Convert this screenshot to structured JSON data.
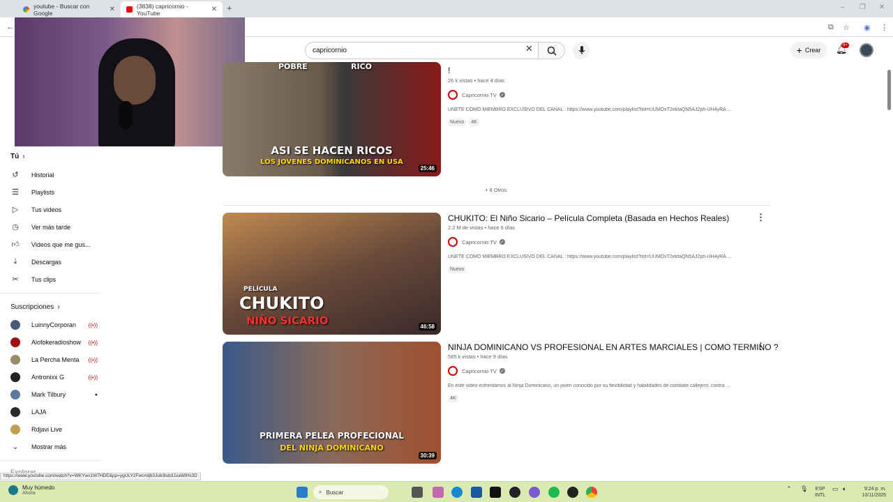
{
  "browser": {
    "tabs": [
      {
        "label": "youtube - Buscar con Google"
      },
      {
        "label": "(3838) capricornio - YouTube"
      }
    ],
    "status_url": "https://www.youtube.com/watch?v=WKYwx1W7HDE&pp=ygULY2Fwcmljb3Jub3lub3JuaW8%3D"
  },
  "header": {
    "search_value": "capricornio",
    "create_label": "Crear",
    "notif_count": "9+"
  },
  "sidebar": {
    "you_label": "Tú",
    "you_items": [
      {
        "label": "Historial",
        "icon": "history-icon"
      },
      {
        "label": "Playlists",
        "icon": "playlist-icon"
      },
      {
        "label": "Tus videos",
        "icon": "video-icon"
      },
      {
        "label": "Ver más tarde",
        "icon": "clock-icon"
      },
      {
        "label": "Videos que me gus...",
        "icon": "thumbs-up-icon"
      },
      {
        "label": "Descargas",
        "icon": "download-icon"
      },
      {
        "label": "Tus clips",
        "icon": "scissors-icon"
      }
    ],
    "subs_label": "Suscripciones",
    "subs": [
      {
        "label": "LuinnyCorporan",
        "status": "live",
        "color": "#4a5a7a"
      },
      {
        "label": "Alofokeradioshow",
        "status": "live",
        "color": "#a01010"
      },
      {
        "label": "La Percha Menta",
        "status": "live",
        "color": "#9a8a6a"
      },
      {
        "label": "Antronixx G",
        "status": "live",
        "color": "#222222"
      },
      {
        "label": "Mark Tilbury",
        "status": "new",
        "color": "#5a7aa0"
      },
      {
        "label": "LAJA",
        "status": "",
        "color": "#2a2a2a"
      },
      {
        "label": "Rdjavi Live",
        "status": "",
        "color": "#c0a050"
      }
    ],
    "show_more": "Mostrar más",
    "explore_label": "Explorar"
  },
  "videos": [
    {
      "title": "!",
      "views": "26 k vistas • hace 4 días",
      "channel": "Capricornio TV",
      "desc": "UNETE COMO MIEMBRO EXCLUSIVO DEL CANAL : https://www.youtube.com/playlist?list=UUMOxT2ekfaQN5AJ2ph-UH4yRA ...",
      "tags": [
        "Nuevo",
        "4K"
      ],
      "duration": "25:46",
      "thumb_text1": "POBRE",
      "thumb_text2": "RICO",
      "thumb_caption1": "ASI SE HACEN RICOS",
      "thumb_caption2": "LOS JOVENES DOMINICANOS EN USA"
    },
    {
      "title": "CHUKITO: El Niño Sicario – Película Completa (Basada en Hechos Reales)",
      "views": "2.2 M de vistas • hace 6 días",
      "channel": "Capricornio TV",
      "desc": "UNETE COMO MIEMBRO EXCLUSIVO DEL CANAL : https://www.youtube.com/playlist?list=UUMOxT2ekfaQN5AJ2ph-UH4yRA ...",
      "tags": [
        "Nuevo"
      ],
      "duration": "46:58",
      "thumb_caption0": "PELÍCULA",
      "thumb_caption1": "CHUKITO",
      "thumb_caption2": "NIÑO SICARIO"
    },
    {
      "title": "NINJA DOMINICANO VS PROFESIONAL EN ARTES MARCIALES | COMO TERMINO ?",
      "views": "585 k vistas • hace 9 días",
      "channel": "Capricornio TV",
      "desc": "En este video enfrentamos al Ninja Dominicano, un joven conocido por su flexibilidad y habilidades de combate callejero, contra ...",
      "tags": [
        "4K"
      ],
      "duration": "30:39",
      "thumb_caption1": "PRIMERA PELEA PROFECIONAL",
      "thumb_caption2": "DEL NINJA DOMINICANO"
    }
  ],
  "otros_label": "+ 8 Otros",
  "taskbar": {
    "weather_title": "Muy húmedo",
    "weather_sub": "Ahora",
    "search_label": "Buscar",
    "lang1": "ESP",
    "lang2": "INTL",
    "time": "9:24 p. m.",
    "date": "10/11/2025"
  }
}
